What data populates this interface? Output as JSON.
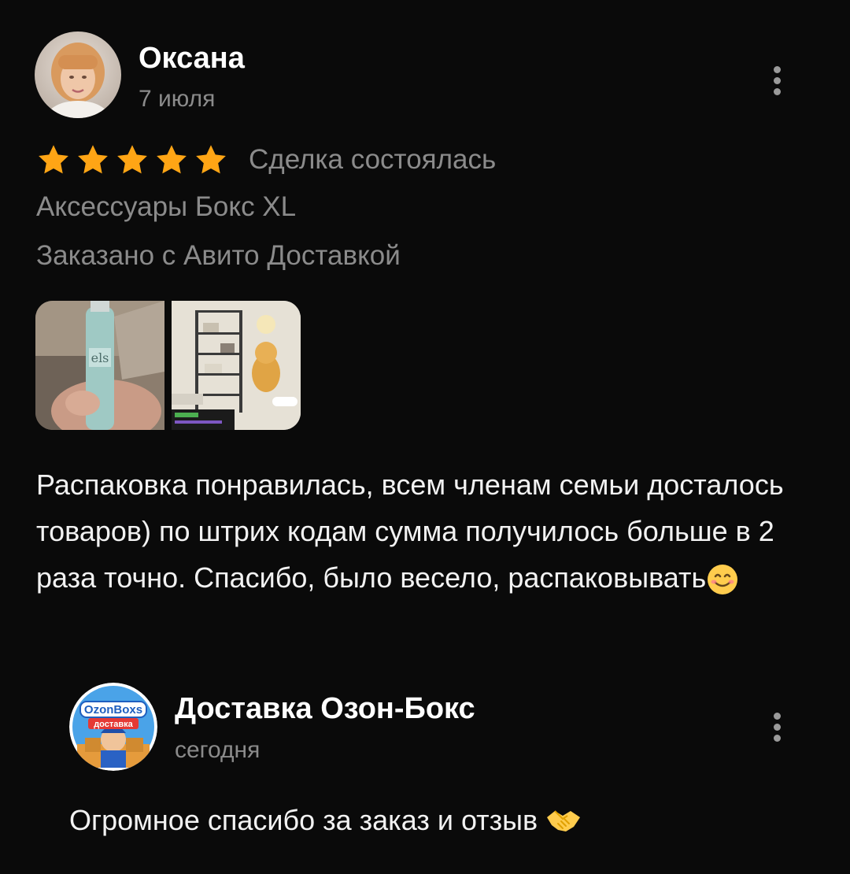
{
  "review": {
    "author": "Оксана",
    "date": "7 июля",
    "rating": 5,
    "rating_max": 5,
    "deal_status": "Сделка состоялась",
    "product": "Аксессуары Бокс XL",
    "order_method": "Заказано с Авито Доставкой",
    "photo_count": 2,
    "text": "Распаковка понравилась, всем членам семьи досталось товаров) по штрих кодам сумма получилось больше в 2 раза точно. Спасибо, было весело, распаковывать",
    "text_emoji": "smiling-face-emoji"
  },
  "reply": {
    "author": "Доставка Озон-Бокс",
    "date": "сегодня",
    "text": "Огромное спасибо за заказ и отзыв",
    "text_emoji": "handshake-emoji",
    "logo_text_top": "OzonBoxs",
    "logo_text_bottom": "доставка"
  },
  "colors": {
    "background": "#0a0a0a",
    "star": "#ffa515",
    "secondary_text": "#8b8b8b",
    "primary_text": "#ffffff"
  },
  "icons": {
    "more": "more-vertical-icon",
    "star": "star-icon"
  }
}
